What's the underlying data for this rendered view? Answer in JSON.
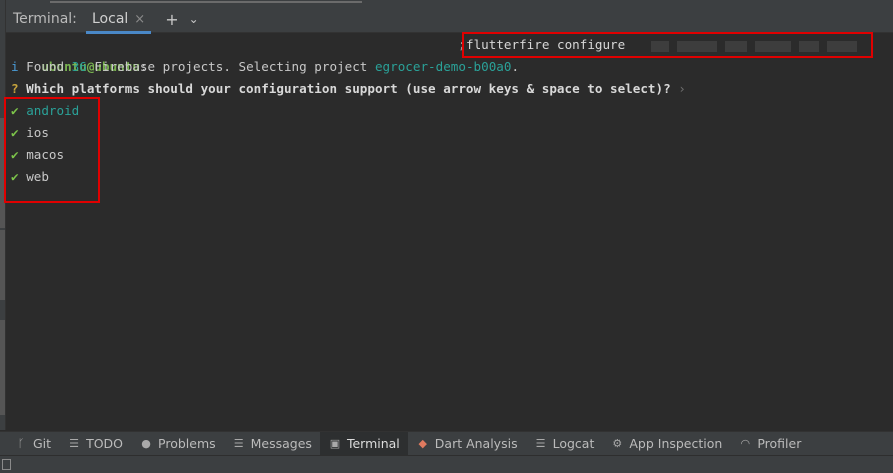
{
  "tab_bar": {
    "title": "Terminal:",
    "active_tab": "Local",
    "close_glyph": "×",
    "add_glyph": "+",
    "menu_glyph": "⌄"
  },
  "terminal": {
    "prompt_user": "ubuntu@ubuntu",
    "prompt_sep": ":",
    "prompt_semicolon": ";",
    "command": "flutterfire configure",
    "line2": {
      "icon": "i",
      "pre": " Found ",
      "count": "36",
      "mid": " Firebase projects. Selecting project ",
      "project": "egrocer-demo-b00a0",
      "post": "."
    },
    "line3": {
      "mark": "?",
      "question": " Which platforms should your configuration support (use arrow keys & space to select)?",
      "hint": " ›"
    },
    "platforms": [
      {
        "check": "✔",
        "label": "android",
        "selected": true
      },
      {
        "check": "✔",
        "label": "ios",
        "selected": false
      },
      {
        "check": "✔",
        "label": "macos",
        "selected": false
      },
      {
        "check": "✔",
        "label": "web",
        "selected": false
      }
    ]
  },
  "bottom_tabs": [
    {
      "icon": "git-icon",
      "glyph": "ᚴ",
      "label": "Git"
    },
    {
      "icon": "todo-icon",
      "glyph": "☰",
      "label": "TODO"
    },
    {
      "icon": "problems-icon",
      "glyph": "●",
      "label": "Problems"
    },
    {
      "icon": "messages-icon",
      "glyph": "☰",
      "label": "Messages"
    },
    {
      "icon": "terminal-icon",
      "glyph": "▣",
      "label": "Terminal",
      "active": true
    },
    {
      "icon": "dart-analysis-icon",
      "glyph": "◆",
      "label": "Dart Analysis"
    },
    {
      "icon": "logcat-icon",
      "glyph": "☰",
      "label": "Logcat"
    },
    {
      "icon": "app-inspection-icon",
      "glyph": "⚙",
      "label": "App Inspection"
    },
    {
      "icon": "profiler-icon",
      "glyph": "◠",
      "label": "Profiler"
    }
  ],
  "colors": {
    "highlight_box": "#e00000",
    "accent": "#4a88c7",
    "teal": "#2aa198",
    "green": "#79b350"
  }
}
